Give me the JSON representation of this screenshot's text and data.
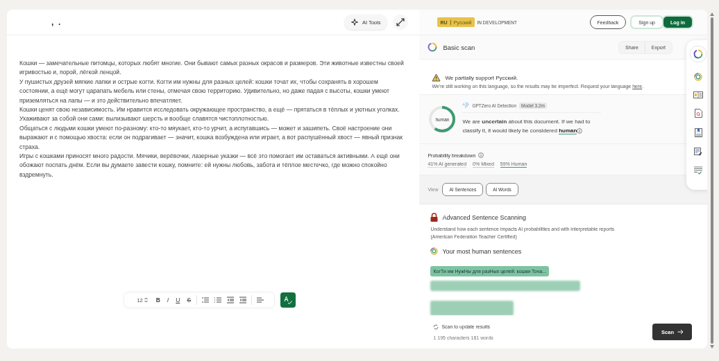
{
  "editor": {
    "title": ",  .",
    "ai_tools": "AI Tools",
    "paragraphs": [
      "Кошки — замечательные питомцы, которых любят многие. Они бывают самых разных окрасов и размеров. Эти животные известны своей игривостью и, порой, лёгкой ленцой.",
      "У пушистых друзей мягкие лапки и острые когти. Когти им нужны для разных целей: кошки точат их, чтобы сохранять в хорошем состоянии, а ещё могут царапать мебель или стены, отмечая свою территорию. Удивительно, но даже падая с высоты, кошки умеют приземляться на лапы — и это действительно впечатляет.",
      "Кошки ценят свою независимость. Им нравится исследовать окружающее пространство, а ещё — прятаться в тёплых и уютных уголках. Ухаживают за собой они сами: вылизывают шерсть и вообще славятся чистоплотностью.",
      "Общаться с людьми кошки умеют по-разному: кто-то мяукает, кто-то урчит, а испугавшись — может и зашипеть. Своё настроение они выражают и с помощью хвоста: если он подрагивает — значит, кошка возбуждена или играет, а вот распушённый хвост — явный признак страха.",
      "Игры с кошками приносят много радости. Мячики, верёвочки, лазерные указки — всё это помогает им оставаться активными. А ещё они обожают поспать днём. Если вы думаете завести кошку, помните: ей нужны любовь, забота и тёплое местечко, где можно спокойно вздремнуть."
    ],
    "toolbar": {
      "font_size": "12",
      "format": [
        {
          "kind": "bold",
          "label": "B"
        },
        {
          "kind": "italic",
          "label": "I"
        },
        {
          "kind": "underline",
          "label": "U"
        },
        {
          "kind": "strike",
          "label": "S"
        }
      ]
    }
  },
  "language": {
    "code": "RU",
    "name": "Русский",
    "status": "IN DEVELOPMENT"
  },
  "header_buttons": [
    {
      "label": "Feedback",
      "kind": "outline"
    },
    {
      "label": "Sign up",
      "kind": "plain"
    },
    {
      "label": "Log in",
      "kind": "primary"
    }
  ],
  "scan": {
    "title": "Basic scan",
    "actions": [
      "Share",
      "Export"
    ]
  },
  "notice": {
    "title": "We partially support Русский.",
    "text": "We're still working on this language, so the results may be imperfect. Request your language",
    "link": "here",
    "end": "."
  },
  "detection": {
    "ring_label": "human",
    "level": 0.6,
    "source": "GPTZero AI Detection",
    "model": "Model 3.2m",
    "verdict": "We are **uncertain** about this document. If we had to classify it, it would likely be considered",
    "verdict_link": "human"
  },
  "breakdown": {
    "title": "Probability breakdown",
    "items": [
      {
        "label": "41% AI generated",
        "color": "#ecdca0"
      },
      {
        "label": "0% Mixed",
        "color": "#c9c6dc"
      },
      {
        "label": "59% Human",
        "color": "#3f9a72"
      }
    ]
  },
  "view": {
    "label": "View",
    "buttons": [
      "AI Sentences",
      "AI Words"
    ]
  },
  "advanced": {
    "title": "Advanced Sentence Scanning",
    "text": "Understand how each sentence impacts AI probabilities and with interpretable reports (American Federation Teacher Certified)"
  },
  "sentences": {
    "title": "Your most human sentences",
    "items": [
      "КогТи им НужНы для разНых целей: кошки Точа..."
    ]
  },
  "footer": {
    "status": "Scan to update results",
    "counts": "1 195 characters 181 words",
    "button": "Scan"
  }
}
